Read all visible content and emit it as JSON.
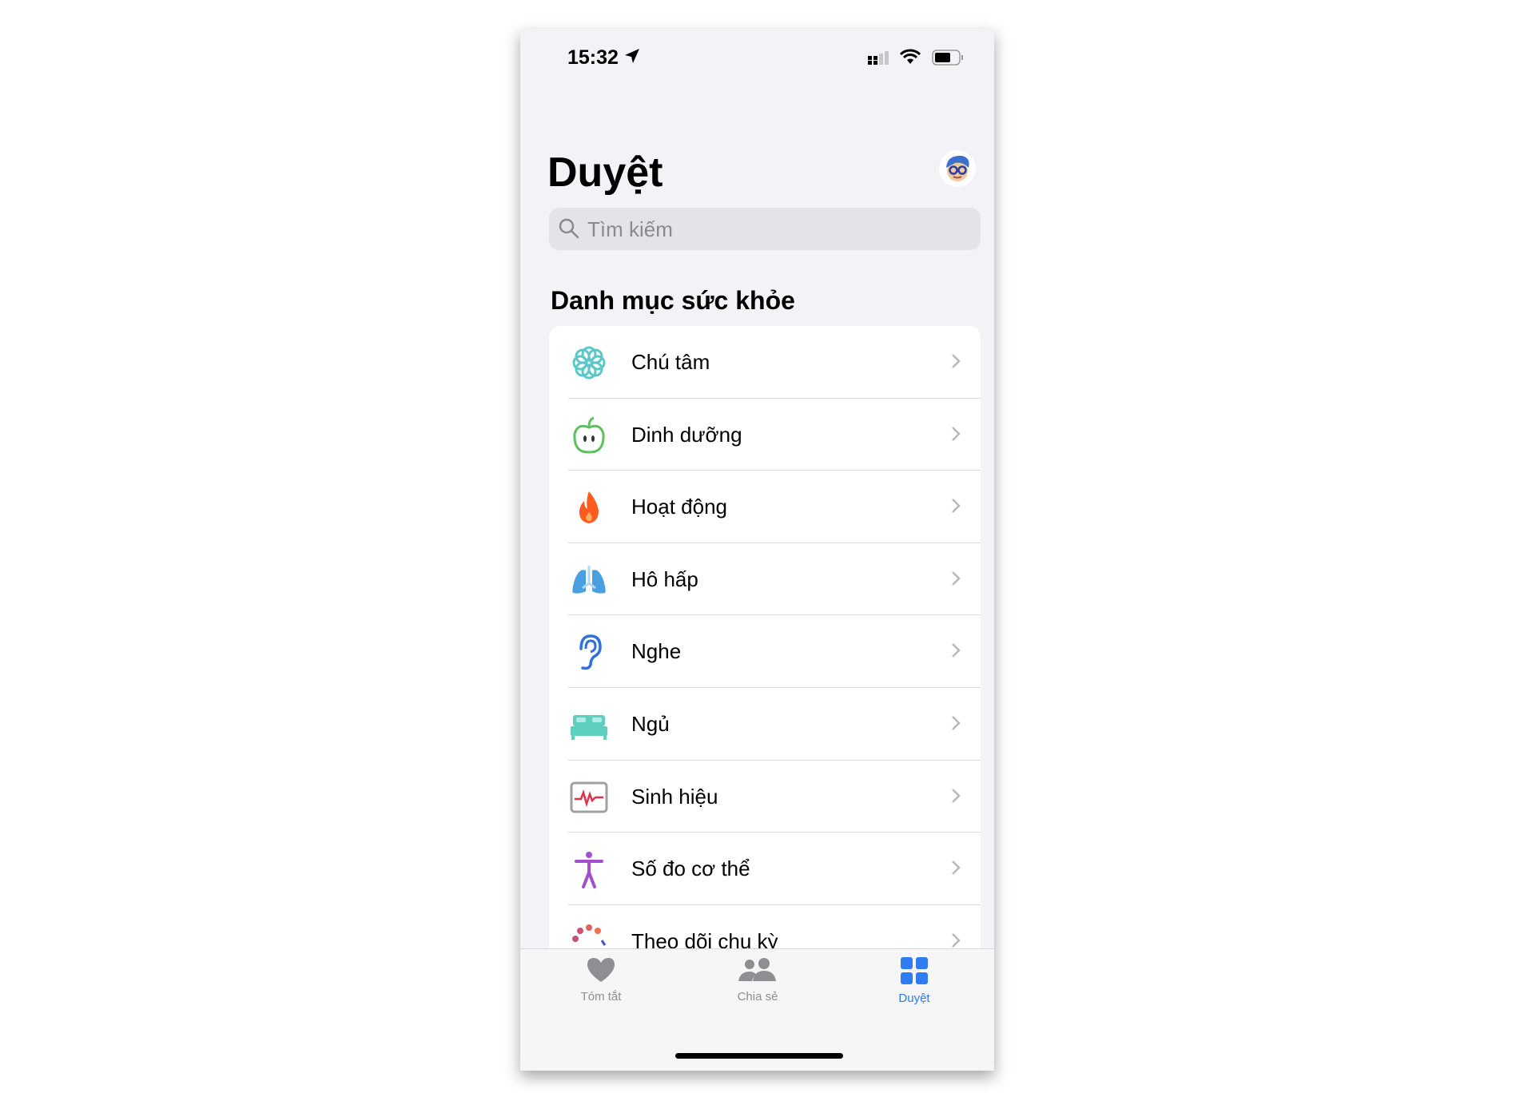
{
  "status_bar": {
    "time": "15:32",
    "location_icon": "location-arrow-icon",
    "signal_icon": "cellular-signal-icon",
    "wifi_icon": "wifi-icon",
    "battery_icon": "battery-icon"
  },
  "header": {
    "title": "Duyệt",
    "avatar_icon": "memoji-avatar-icon"
  },
  "search": {
    "placeholder": "Tìm kiếm",
    "value": ""
  },
  "section": {
    "title": "Danh mục sức khỏe"
  },
  "categories": [
    {
      "label": "Chú tâm",
      "icon": "mindfulness-icon",
      "color": "#5ac8c8"
    },
    {
      "label": "Dinh dưỡng",
      "icon": "apple-icon",
      "color": "#5cc05c"
    },
    {
      "label": "Hoạt động",
      "icon": "flame-icon",
      "color": "#ff5a1f"
    },
    {
      "label": "Hô hấp",
      "icon": "lungs-icon",
      "color": "#4a9fe0"
    },
    {
      "label": "Nghe",
      "icon": "ear-icon",
      "color": "#2f6fe0"
    },
    {
      "label": "Ngủ",
      "icon": "bed-icon",
      "color": "#5dd0c0"
    },
    {
      "label": "Sinh hiệu",
      "icon": "vitals-icon",
      "color": "#e0304a"
    },
    {
      "label": "Số đo cơ thể",
      "icon": "body-figure-icon",
      "color": "#a050d0"
    },
    {
      "label": "Theo dõi chu kỳ",
      "icon": "cycle-tracking-icon",
      "color": "#e06060"
    }
  ],
  "tabs": [
    {
      "label": "Tóm tắt",
      "icon": "heart-icon",
      "active": false
    },
    {
      "label": "Chia sẻ",
      "icon": "people-icon",
      "active": false
    },
    {
      "label": "Duyệt",
      "icon": "grid-icon",
      "active": true
    }
  ],
  "colors": {
    "accent": "#2f7bf0",
    "background": "#f2f2f7"
  }
}
